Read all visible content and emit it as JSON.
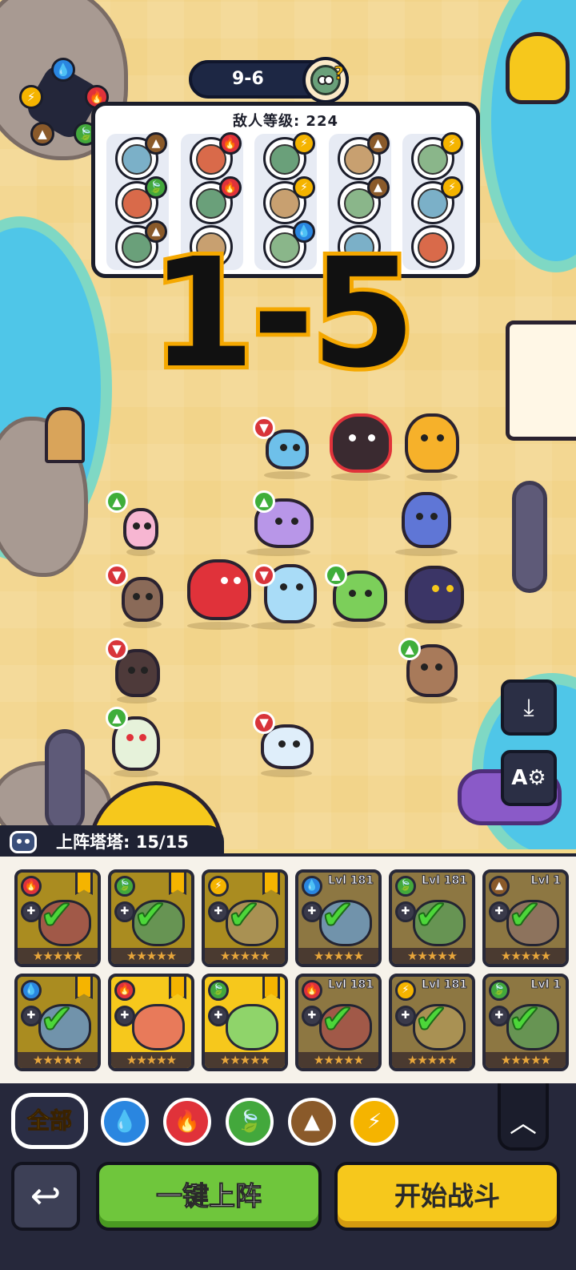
{
  "stage": {
    "level": "9-6",
    "enemy_level_label": "敌人等级: 224",
    "wave_overlay": "1-5"
  },
  "colors": {
    "water": "#2a86e0",
    "fire": "#e0323a",
    "nature": "#43a83c",
    "earth": "#8a5a2a",
    "lightning": "#f5b400"
  },
  "element_icons": {
    "water": "water-drop-icon",
    "fire": "fire-icon",
    "nature": "leaf-icon",
    "earth": "mountain-icon",
    "lightning": "lightning-icon"
  },
  "enemy_columns": [
    {
      "enemies": [
        "earth",
        "nature",
        "earth"
      ]
    },
    {
      "enemies": [
        "fire",
        "fire",
        "none"
      ]
    },
    {
      "enemies": [
        "lightning",
        "lightning",
        "water"
      ]
    },
    {
      "enemies": [
        "earth",
        "earth",
        "none"
      ]
    },
    {
      "enemies": [
        "lightning",
        "lightning",
        "none"
      ]
    }
  ],
  "deploy": {
    "label": "上阵塔塔: 15/15"
  },
  "roster_cards": [
    {
      "element": "fire",
      "level": "",
      "starred": true,
      "stars": "★★★★★",
      "deployed": true
    },
    {
      "element": "nature",
      "level": "",
      "starred": true,
      "stars": "★★★★★",
      "deployed": true
    },
    {
      "element": "lightning",
      "level": "",
      "starred": true,
      "stars": "★★★★★",
      "deployed": true
    },
    {
      "element": "water",
      "level": "Lvl 181",
      "starred": false,
      "stars": "★★★★★",
      "deployed": true
    },
    {
      "element": "nature",
      "level": "Lvl 181",
      "starred": false,
      "stars": "★★★★★",
      "deployed": true
    },
    {
      "element": "earth",
      "level": "Lvl 1",
      "starred": false,
      "stars": "★★★★★",
      "deployed": true
    },
    {
      "element": "water",
      "level": "",
      "starred": true,
      "stars": "★★★★★",
      "deployed": true
    },
    {
      "element": "fire",
      "level": "",
      "starred": true,
      "stars": "★★★★★",
      "deployed": false
    },
    {
      "element": "nature",
      "level": "",
      "starred": true,
      "stars": "★★★★★",
      "deployed": false
    },
    {
      "element": "fire",
      "level": "Lvl 181",
      "starred": false,
      "stars": "★★★★★",
      "deployed": true
    },
    {
      "element": "lightning",
      "level": "Lvl 181",
      "starred": false,
      "stars": "★★★★★",
      "deployed": true
    },
    {
      "element": "nature",
      "level": "Lvl 1",
      "starred": false,
      "stars": "★★★★★",
      "deployed": true
    }
  ],
  "filters": {
    "all_label": "全部",
    "chips": [
      "water",
      "fire",
      "nature",
      "earth",
      "lightning"
    ]
  },
  "actions": {
    "auto_deploy": "一键上阵",
    "start_battle": "开始战斗"
  }
}
